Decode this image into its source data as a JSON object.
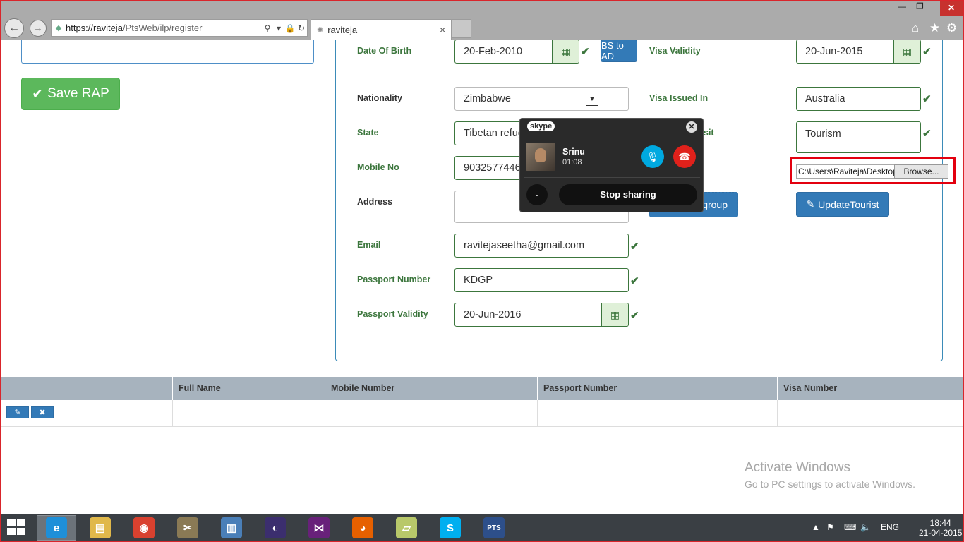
{
  "browser": {
    "url_host": "https://raviteja",
    "url_path": "/PtsWeb/ilp/register",
    "tab_title": "raviteja",
    "tab_close": "×",
    "back_glyph": "←",
    "forward_glyph": "→",
    "search_glyph": "⚲",
    "dropdown_glyph": "▾",
    "lock_glyph": "🔒",
    "refresh_glyph": "↻",
    "min_glyph": "—",
    "max_glyph": "❐",
    "close_glyph": "✕",
    "home_glyph": "⌂",
    "favorites_glyph": "★",
    "tools_glyph": "⚙"
  },
  "form": {
    "save_label": "Save RAP",
    "check_glyph": "✔",
    "calendar_glyph": "▦",
    "date_of_birth_label": "Date Of Birth",
    "date_of_birth_value": "20-Feb-2010",
    "bs_to_ad_label": "BS to AD",
    "nationality_label": "Nationality",
    "nationality_value": "Zimbabwe",
    "select_arrow": "▼",
    "state_label": "State",
    "state_value": "Tibetan refug",
    "mobile_label": "Mobile No",
    "mobile_value": "9032577446",
    "address_label": "Address",
    "email_label": "Email",
    "email_value": "ravitejaseetha@gmail.com",
    "passport_number_label": "Passport Number",
    "passport_number_value": "KDGP",
    "passport_validity_label": "Passport Validity",
    "passport_validity_value": "20-Jun-2016",
    "visa_validity_label": "Visa Validity",
    "visa_validity_value": "20-Jun-2015",
    "visa_issued_label": "Visa Issued In",
    "visa_issued_value": "Australia",
    "purpose_label_partial": "sit",
    "purpose_value": "Tourism",
    "file_path": "C:\\Users\\Raviteja\\Desktop",
    "browse_label": "Browse...",
    "group_button_partial": "group",
    "update_label": "UpdateTourist",
    "update_glyph": "✎"
  },
  "table": {
    "columns": [
      "",
      "Full Name",
      "Mobile Number",
      "Passport Number",
      "Visa Number"
    ],
    "edit_glyph": "✎",
    "delete_glyph": "✖"
  },
  "skype": {
    "logo": "skype",
    "close_glyph": "✕",
    "caller_name": "Srinu",
    "call_time": "01:08",
    "mic_glyph": "🎙",
    "end_glyph": "☎",
    "expand_glyph": "⌄",
    "stop_label": "Stop sharing"
  },
  "watermark": {
    "title": "Activate Windows",
    "subtitle": "Go to PC settings to activate Windows."
  },
  "taskbar": {
    "apps": [
      {
        "name": "internet-explorer",
        "glyph": "e",
        "color": "#1e8fd8"
      },
      {
        "name": "file-explorer",
        "glyph": "▤",
        "color": "#e0b84a"
      },
      {
        "name": "chrome",
        "glyph": "◉",
        "color": "#d9412f"
      },
      {
        "name": "tools",
        "glyph": "✂",
        "color": "#8a7a55"
      },
      {
        "name": "database",
        "glyph": "▥",
        "color": "#4a7fb8"
      },
      {
        "name": "eclipse",
        "glyph": "◐",
        "color": "#3b2e6e"
      },
      {
        "name": "visual-studio",
        "glyph": "⋈",
        "color": "#68217a"
      },
      {
        "name": "firefox",
        "glyph": "◕",
        "color": "#e66000"
      },
      {
        "name": "sticky-notes",
        "glyph": "▱",
        "color": "#b8c86a"
      },
      {
        "name": "skype",
        "glyph": "S",
        "color": "#00aff0"
      },
      {
        "name": "pts",
        "glyph": "PTS",
        "color": "#2d4f8a"
      }
    ],
    "tray_up": "▲",
    "tray_flag": "⚑",
    "tray_network": "⌨",
    "tray_volume": "🔈",
    "language": "ENG",
    "time": "18:44",
    "date": "21-04-2015"
  }
}
